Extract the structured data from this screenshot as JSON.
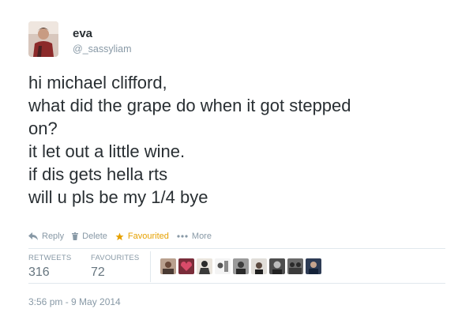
{
  "user": {
    "display_name": "eva",
    "handle": "@_sassyliam"
  },
  "tweet": {
    "lines": [
      "hi michael clifford,",
      "what did the grape do when it got stepped",
      "on?",
      "it let out a little wine.",
      "if dis gets hella rts",
      "will u pls be my 1/4 bye"
    ]
  },
  "actions": {
    "reply": "Reply",
    "delete": "Delete",
    "favourited": "Favourited",
    "more": "More"
  },
  "stats": {
    "retweets_label": "RETWEETS",
    "retweets_value": "316",
    "favourites_label": "FAVOURITES",
    "favourites_value": "72"
  },
  "timestamp": "3:56 pm - 9 May 2014",
  "colors": {
    "favourite": "#e6a100",
    "muted": "#8899a6"
  }
}
